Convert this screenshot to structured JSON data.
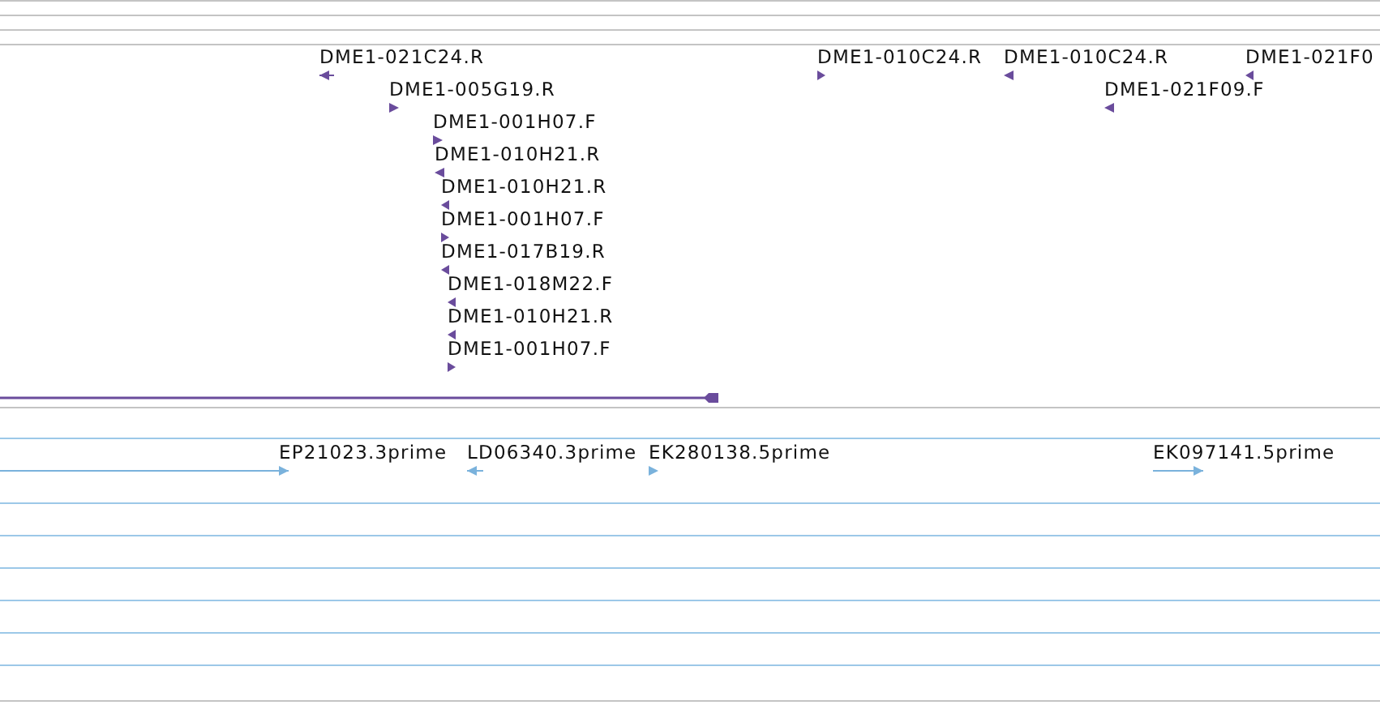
{
  "tracks": [
    {
      "color": "#6a4c9c",
      "features": [
        {
          "kind": "arrow",
          "label": "DME1-021C24.R",
          "reverse": true
        },
        {
          "kind": "arrow",
          "label": "DME1-005G19.R",
          "reverse": false
        },
        {
          "kind": "arrow",
          "label": "DME1-001H07.F",
          "reverse": false
        },
        {
          "kind": "arrow",
          "label": "DME1-010H21.R",
          "reverse": true
        },
        {
          "kind": "arrow",
          "label": "DME1-010H21.R",
          "reverse": true
        },
        {
          "kind": "arrow",
          "label": "DME1-001H07.F",
          "reverse": false
        },
        {
          "kind": "arrow",
          "label": "DME1-017B19.R",
          "reverse": true
        },
        {
          "kind": "arrow",
          "label": "DME1-018M22.F",
          "reverse": true
        },
        {
          "kind": "arrow",
          "label": "DME1-010H21.R",
          "reverse": true
        },
        {
          "kind": "arrow",
          "label": "DME1-001H07.F",
          "reverse": false
        },
        {
          "kind": "arrow",
          "label": "DME1-010C24.R",
          "reverse": false
        },
        {
          "kind": "arrow",
          "label": "DME1-010C24.R",
          "reverse": true
        },
        {
          "kind": "arrow",
          "label": "DME1-021F09.F",
          "reverse": true
        },
        {
          "kind": "arrow",
          "label": "DME1-021F0",
          "reverse": true
        },
        {
          "kind": "span"
        }
      ]
    },
    {
      "color": "#7ab2dc",
      "features": [
        {
          "kind": "arrow",
          "label": "EP21023.3prime",
          "reverse": false
        },
        {
          "kind": "arrow",
          "label": "LD06340.3prime",
          "reverse": true
        },
        {
          "kind": "arrow",
          "label": "EK280138.5prime",
          "reverse": false
        },
        {
          "kind": "arrow",
          "label": "EK097141.5prime",
          "reverse": false
        }
      ]
    }
  ]
}
